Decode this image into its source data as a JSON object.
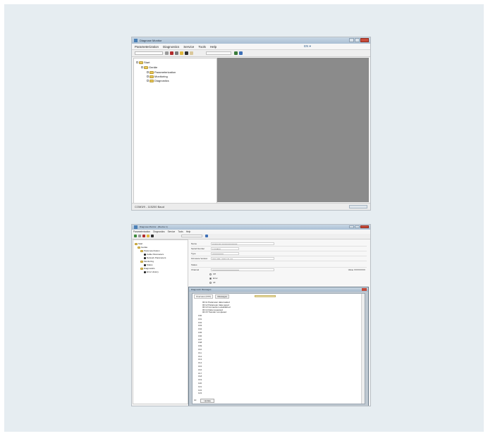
{
  "screenshot1": {
    "window_title": "Diagnose Monitor",
    "menu": [
      "Parameterization",
      "Diagnostics",
      "Service",
      "Tools",
      "Help"
    ],
    "language": "EN ▾",
    "tree": [
      {
        "label": "Start",
        "level": 0
      },
      {
        "label": "Geräte",
        "level": 1
      },
      {
        "label": "Parameterization",
        "level": 2
      },
      {
        "label": "Monitoring",
        "level": 2
      },
      {
        "label": "Diagnostics",
        "level": 2
      }
    ],
    "status_left": "COM3/9 - 115200 Baud"
  },
  "screenshot2": {
    "window_title": "Diagnose Monitor - [Device 1]",
    "menu": [
      "Parameterization",
      "Diagnostics",
      "Service",
      "Tools",
      "Help"
    ],
    "tree": [
      {
        "label": "Start",
        "level": 0
      },
      {
        "label": "Geräte",
        "level": 1
      },
      {
        "label": "Parameterization",
        "level": 2
      },
      {
        "label": "Cable Parameters",
        "level": 3
      },
      {
        "label": "Network Parameters",
        "level": 3
      },
      {
        "label": "Monitoring",
        "level": 2
      },
      {
        "label": "Status",
        "level": 3
      },
      {
        "label": "Diagnostics",
        "level": 2
      },
      {
        "label": "Error History",
        "level": 3
      }
    ],
    "properties": [
      {
        "label": "Name",
        "value": "SENSOR XXXXXXXXXXX"
      },
      {
        "label": "Serial Number",
        "value": "1234567"
      },
      {
        "label": "Type",
        "value": "XXXXXXXX"
      },
      {
        "label": "Firmware Version",
        "value": "V01.000 / 2010-01-01"
      },
      {
        "label": "Status",
        "value": ""
      },
      {
        "label": "Channel",
        "value": "XXXXXXXXXXXXXXXXXXX",
        "extra": "Value  XXXXXXXX"
      }
    ],
    "radio_options": [
      "Off",
      "Error",
      "All"
    ],
    "dialog": {
      "title": "Diagnostic Messages",
      "tabs": [
        "Overview (XXX)",
        "Messages"
      ],
      "message_lines": [
        "00:11 Parameter data loaded",
        "00:12 Parameter data saved",
        "00:13 Connection established",
        "00:14 Data requested",
        "00:15 Transfer completed"
      ],
      "rows": [
        "0:00",
        "0:01",
        "0:02",
        "0:03",
        "0:04",
        "0:05",
        "0:06",
        "0:07",
        "0:08",
        "0:09",
        "0:10",
        "0:11",
        "0:12",
        "0:13",
        "0:14",
        "0:15",
        "0:16",
        "0:17",
        "0:18",
        "0:19",
        "0:20",
        "0:21",
        "0:22",
        "0:23"
      ],
      "bottom_value": "10",
      "bottom_button": "Update"
    }
  }
}
